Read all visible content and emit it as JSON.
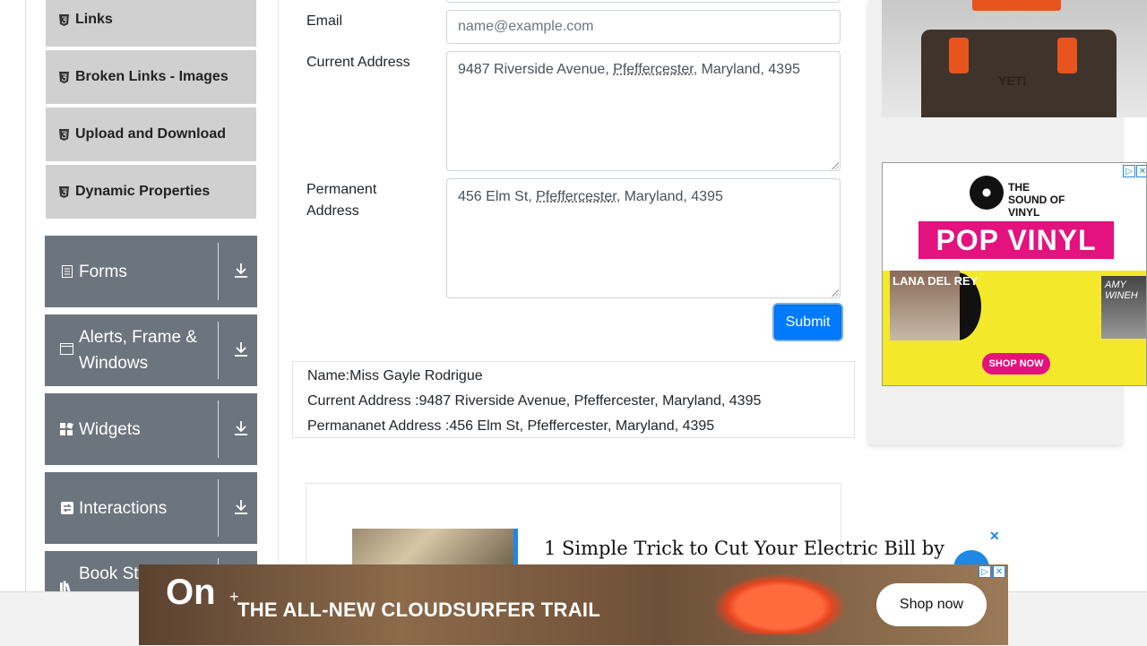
{
  "sidebar": {
    "elements_items": [
      {
        "label": "Links"
      },
      {
        "label": "Broken Links - Images"
      },
      {
        "label": "Upload and Download"
      },
      {
        "label": "Dynamic Properties"
      }
    ],
    "groups": [
      {
        "label": "Forms",
        "icon": "document-icon"
      },
      {
        "label": "Alerts, Frame & Windows",
        "icon": "window-icon"
      },
      {
        "label": "Widgets",
        "icon": "widgets-icon"
      },
      {
        "label": "Interactions",
        "icon": "interactions-icon"
      },
      {
        "label": "Book Store Application",
        "icon": "books-icon"
      }
    ]
  },
  "form": {
    "email_label": "Email",
    "email_placeholder": "name@example.com",
    "current_address_label": "Current Address",
    "current_address_value": {
      "pre": "9487 Riverside Avenue, ",
      "city": "Pfeffercester",
      "post": ", Maryland, 4395"
    },
    "permanent_address_label": "Permanent Address",
    "permanent_address_value": {
      "pre": "456 Elm St, ",
      "city": "Pfeffercester",
      "post": ", Maryland, 4395"
    },
    "submit_label": "Submit"
  },
  "output": {
    "name": "Name:Miss Gayle Rodrigue",
    "current_address": "Current Address :9487 Riverside Avenue, Pfeffercester, Maryland, 4395",
    "permanent_address": "Permananet Address :456 Elm St, Pfeffercester, Maryland, 4395"
  },
  "promo": {
    "headline": "1 Simple Trick to Cut Your Electric Bill by",
    "close": "✕"
  },
  "ads": {
    "cooler_logo": "YETI",
    "vinyl_sound": "THE SOUND OF VINYL",
    "vinyl_title": "POP VINYL",
    "album1": "LANA DEL REY",
    "album2": "AMY WINEH",
    "vinyl_cta": "SHOP NOW",
    "banner_text": "THE ALL-NEW CLOUDSURFER TRAIL",
    "banner_cta": "Shop now",
    "banner_brand": "On",
    "adchoices": "▷",
    "close": "✕"
  },
  "colors": {
    "primary": "#007bff",
    "sidebar_group": "#6c757d",
    "sidebar_item": "#d0d0d0"
  }
}
